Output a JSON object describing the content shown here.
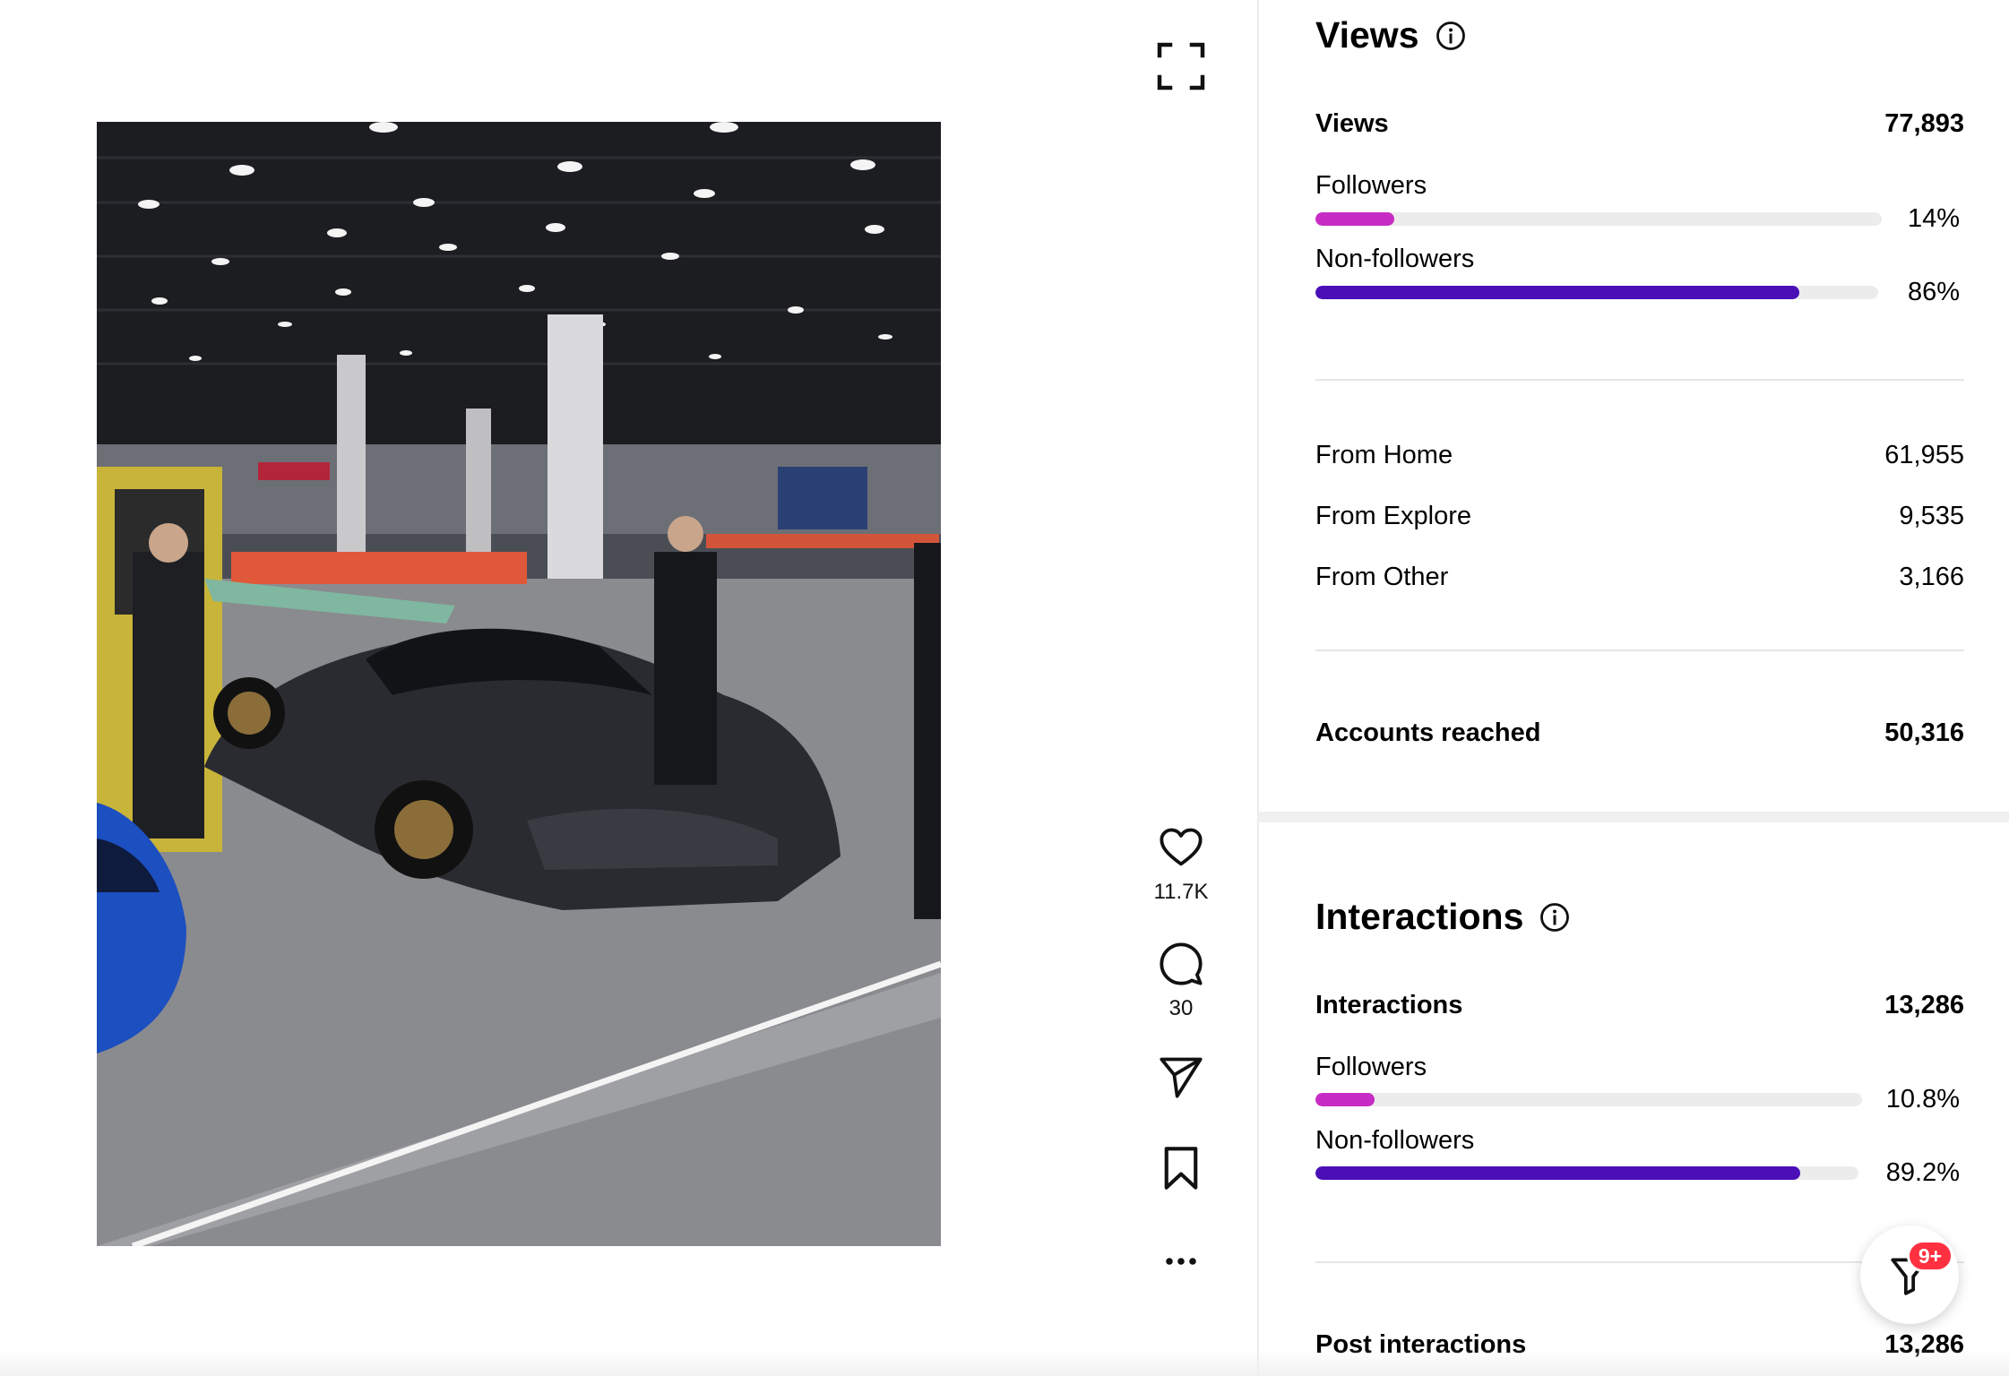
{
  "post": {
    "actions": {
      "likes_count": "11.7K",
      "comments_count": "30"
    }
  },
  "insights": {
    "views_section": {
      "title": "Views",
      "total_label": "Views",
      "total_value": "77,893",
      "breakdown": [
        {
          "label": "Followers",
          "percent_text": "14%",
          "fraction": 0.14,
          "color": "#c72cc4"
        },
        {
          "label": "Non-followers",
          "percent_text": "86%",
          "fraction": 0.86,
          "color": "#4a0fb7"
        }
      ],
      "sources": [
        {
          "label": "From Home",
          "value": "61,955"
        },
        {
          "label": "From Explore",
          "value": "9,535"
        },
        {
          "label": "From Other",
          "value": "3,166"
        }
      ],
      "accounts_reached_label": "Accounts reached",
      "accounts_reached_value": "50,316"
    },
    "interactions_section": {
      "title": "Interactions",
      "total_label": "Interactions",
      "total_value": "13,286",
      "breakdown": [
        {
          "label": "Followers",
          "percent_text": "10.8%",
          "fraction": 0.108,
          "color": "#c72cc4"
        },
        {
          "label": "Non-followers",
          "percent_text": "89.2%",
          "fraction": 0.892,
          "color": "#4a0fb7"
        }
      ],
      "post_interactions_label": "Post interactions",
      "post_interactions_value": "13,286"
    }
  },
  "notifications": {
    "badge": "9+"
  },
  "icons": {
    "expand": "expand-icon",
    "like": "heart-icon",
    "comment": "comment-icon",
    "share": "send-icon",
    "save": "bookmark-icon",
    "more": "more-icon",
    "info": "info-icon",
    "filter": "filter-icon"
  }
}
